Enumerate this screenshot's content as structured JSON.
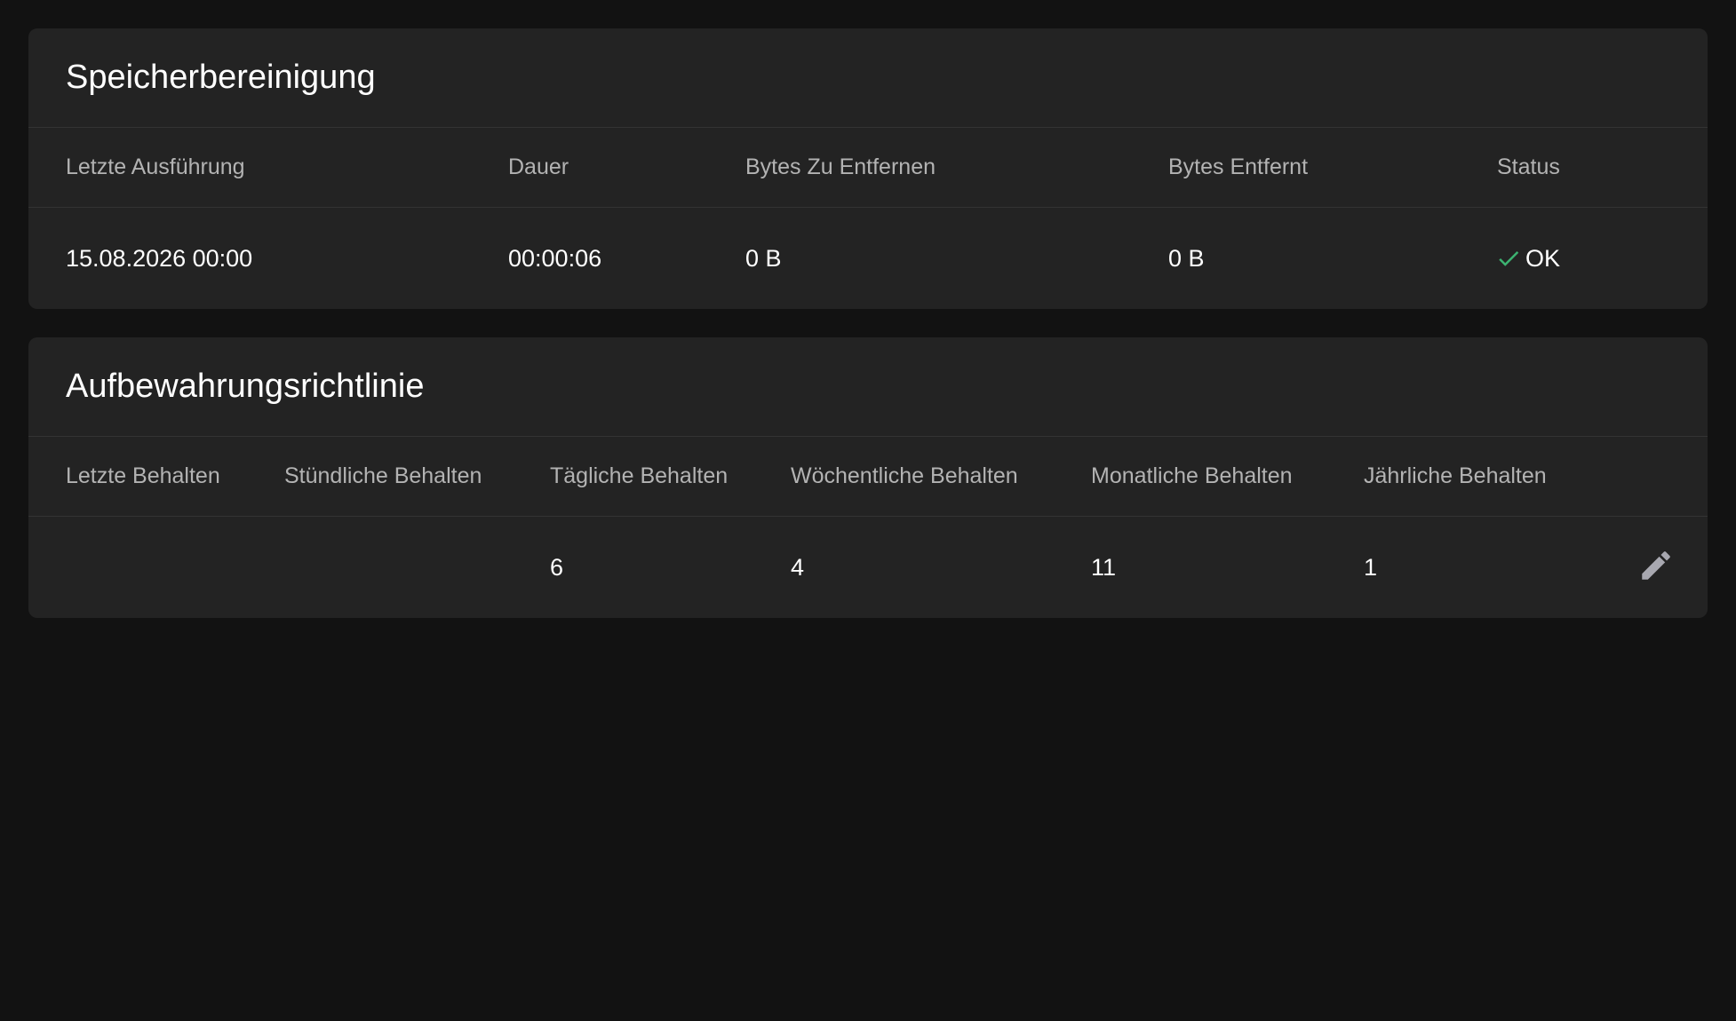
{
  "cleanup": {
    "title": "Speicherbereinigung",
    "headers": {
      "last_run": "Letzte Ausführung",
      "duration": "Dauer",
      "bytes_to_remove": "Bytes Zu Entfernen",
      "bytes_removed": "Bytes Entfernt",
      "status": "Status"
    },
    "row": {
      "last_run": "15.08.2026 00:00",
      "duration": "00:00:06",
      "bytes_to_remove": "0 B",
      "bytes_removed": "0 B",
      "status": "OK",
      "status_icon": "check-icon",
      "status_color": "#3cb371"
    }
  },
  "retention": {
    "title": "Aufbewahrungsrichtlinie",
    "headers": {
      "keep_last": "Letzte Behalten",
      "keep_hourly": "Stündliche Behalten",
      "keep_daily": "Tägliche Behalten",
      "keep_weekly": "Wöchentliche Behalten",
      "keep_monthly": "Monatliche Behalten",
      "keep_yearly": "Jährliche Behalten"
    },
    "row": {
      "keep_last": "",
      "keep_hourly": "",
      "keep_daily": "6",
      "keep_weekly": "4",
      "keep_monthly": "11",
      "keep_yearly": "1",
      "edit_icon": "pencil-icon"
    }
  },
  "colors": {
    "background": "#121212",
    "card": "#232323",
    "header_text": "#b3b3b3",
    "ok_green": "#3cb371",
    "icon_gray": "#a8a8b0"
  }
}
